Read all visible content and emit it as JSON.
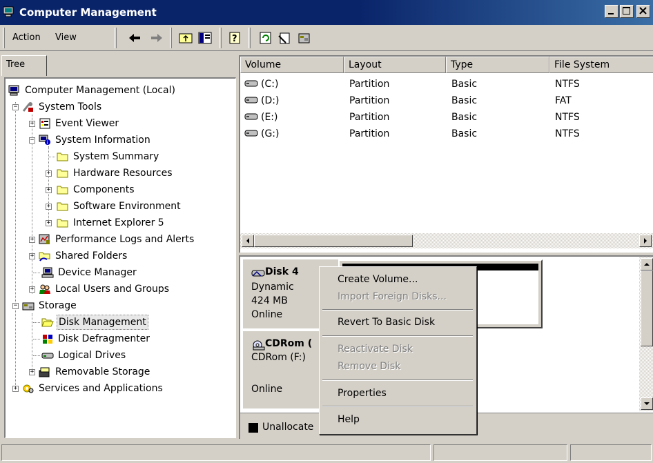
{
  "window": {
    "title": "Computer Management"
  },
  "toolbar": {
    "action_label": "Action",
    "view_label": "View"
  },
  "tree": {
    "tab_label": "Tree",
    "nodes": [
      {
        "label": "Computer Management (Local)"
      },
      {
        "label": "System Tools"
      },
      {
        "label": "Event Viewer"
      },
      {
        "label": "System Information"
      },
      {
        "label": "System Summary"
      },
      {
        "label": "Hardware Resources"
      },
      {
        "label": "Components"
      },
      {
        "label": "Software Environment"
      },
      {
        "label": "Internet Explorer 5"
      },
      {
        "label": "Performance Logs and Alerts"
      },
      {
        "label": "Shared Folders"
      },
      {
        "label": "Device Manager"
      },
      {
        "label": "Local Users and Groups"
      },
      {
        "label": "Storage"
      },
      {
        "label": "Disk Management"
      },
      {
        "label": "Disk Defragmenter"
      },
      {
        "label": "Logical Drives"
      },
      {
        "label": "Removable Storage"
      },
      {
        "label": "Services and Applications"
      }
    ]
  },
  "volumes": {
    "columns": [
      "Volume",
      "Layout",
      "Type",
      "File System"
    ],
    "rows": [
      {
        "volume": "(C:)",
        "layout": "Partition",
        "type": "Basic",
        "fs": "NTFS"
      },
      {
        "volume": "(D:)",
        "layout": "Partition",
        "type": "Basic",
        "fs": "FAT"
      },
      {
        "volume": "(E:)",
        "layout": "Partition",
        "type": "Basic",
        "fs": "NTFS"
      },
      {
        "volume": "(G:)",
        "layout": "Partition",
        "type": "Basic",
        "fs": "NTFS"
      }
    ]
  },
  "disks": {
    "disk4": {
      "name": "Disk 4",
      "kind": "Dynamic",
      "size": "424 MB",
      "status": "Online"
    },
    "cdrom": {
      "name": "CDRom (",
      "drive": "CDRom (F:)",
      "status": "Online"
    },
    "legend": {
      "unallocated": "Unallocate"
    }
  },
  "context_menu": {
    "items": [
      {
        "label": "Create Volume..."
      },
      {
        "label": "Import Foreign Disks..."
      },
      {
        "label": "Revert To Basic Disk"
      },
      {
        "label": "Reactivate Disk"
      },
      {
        "label": "Remove Disk"
      },
      {
        "label": "Properties"
      },
      {
        "label": "Help"
      }
    ]
  },
  "colors": {
    "titlebar": "#0a246a",
    "selection": "#e8e8e8",
    "unallocated": "#000000"
  }
}
